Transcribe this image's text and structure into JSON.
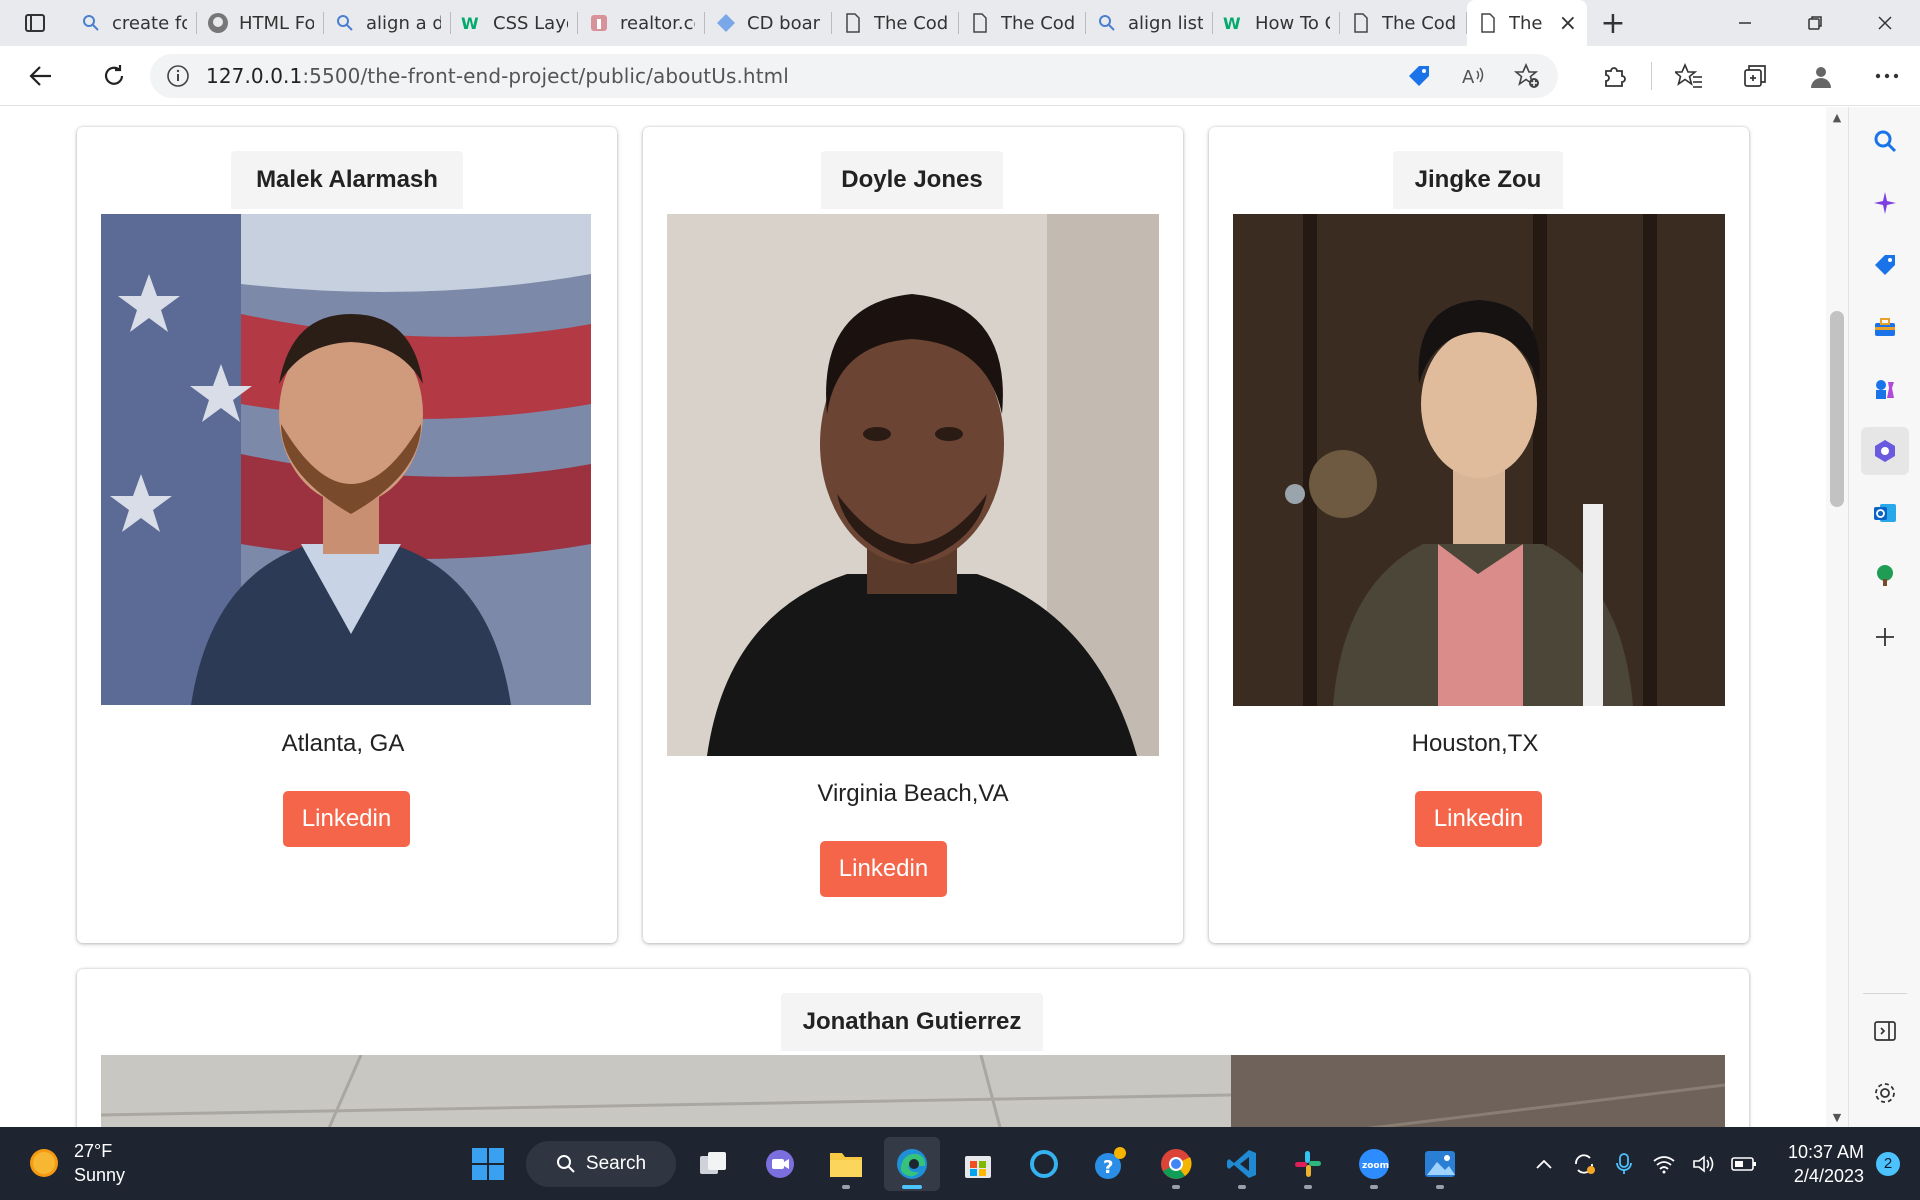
{
  "browser": {
    "tabs": [
      {
        "title": "create fo",
        "icon": "search-icon"
      },
      {
        "title": "HTML Fo",
        "icon": "github-icon"
      },
      {
        "title": "align a d",
        "icon": "search-icon"
      },
      {
        "title": "CSS Layo",
        "icon": "w3schools-icon"
      },
      {
        "title": "realtor.co",
        "icon": "realtor-icon"
      },
      {
        "title": "CD boar",
        "icon": "diamond-icon"
      },
      {
        "title": "The Codi",
        "icon": "page-icon"
      },
      {
        "title": "The Codi",
        "icon": "page-icon"
      },
      {
        "title": "align list",
        "icon": "search-icon"
      },
      {
        "title": "How To C",
        "icon": "w3schools-icon"
      },
      {
        "title": "The Codi",
        "icon": "page-icon"
      }
    ],
    "active_tab": {
      "title": "The",
      "icon": "page-icon"
    },
    "url_host": "127.0.0.1",
    "url_path": ":5500/the-front-end-project/public/aboutUs.html"
  },
  "members": [
    {
      "name": "Malek Alarmash",
      "location": "Atlanta, GA",
      "link_label": "Linkedin"
    },
    {
      "name": "Doyle Jones",
      "location": "Virginia Beach,VA",
      "link_label": "Linkedin"
    },
    {
      "name": "Jingke Zou",
      "location": "Houston,TX",
      "link_label": "Linkedin"
    },
    {
      "name": "Jonathan Gutierrez"
    }
  ],
  "colors": {
    "button": "#f4654a",
    "tab_bg": "#e9eaed",
    "taskbar_bg": "#1f2530"
  },
  "taskbar": {
    "temp": "27°F",
    "condition": "Sunny",
    "search_label": "Search",
    "time": "10:37 AM",
    "date": "2/4/2023",
    "notifications": "2"
  }
}
